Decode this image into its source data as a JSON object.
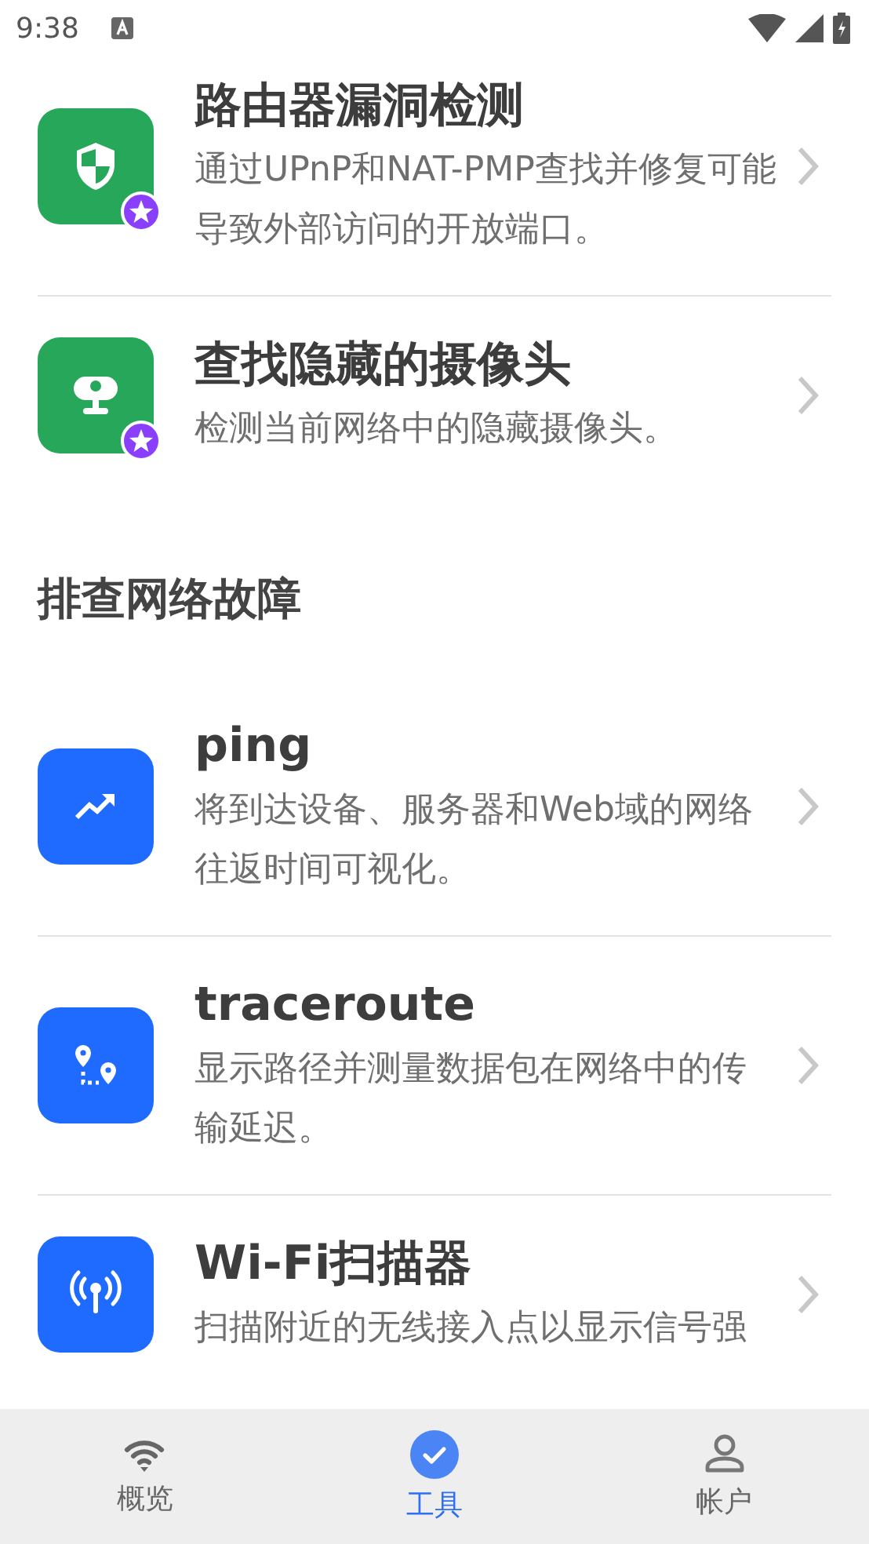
{
  "status_bar": {
    "time": "9:38"
  },
  "sections": [
    {
      "items": [
        {
          "kind": "shield",
          "color": "#27a75a",
          "premium": true,
          "title": "路由器漏洞检测",
          "description": "通过UPnP和NAT-PMP查找并修复可能导致外部访问的开放端口。"
        },
        {
          "kind": "camera",
          "color": "#27a75a",
          "premium": true,
          "title": "查找隐藏的摄像头",
          "description": "检测当前网络中的隐藏摄像头。"
        }
      ]
    },
    {
      "title": "排查网络故障",
      "items": [
        {
          "kind": "trend",
          "color": "#1f6bff",
          "premium": false,
          "title": "ping",
          "description": "将到达设备、服务器和Web域的网络往返时间可视化。"
        },
        {
          "kind": "route",
          "color": "#1f6bff",
          "premium": false,
          "title": "traceroute",
          "description": "显示路径并测量数据包在网络中的传输延迟。"
        },
        {
          "kind": "antenna",
          "color": "#1f6bff",
          "premium": false,
          "title": "Wi-Fi扫描器",
          "description": "扫描附近的无线接入点以显示信号强"
        }
      ]
    }
  ],
  "bottom_nav": [
    {
      "kind": "wifi",
      "label": "概览",
      "selected": false
    },
    {
      "kind": "check",
      "label": "工具",
      "selected": true
    },
    {
      "kind": "person",
      "label": "帐户",
      "selected": false
    }
  ]
}
